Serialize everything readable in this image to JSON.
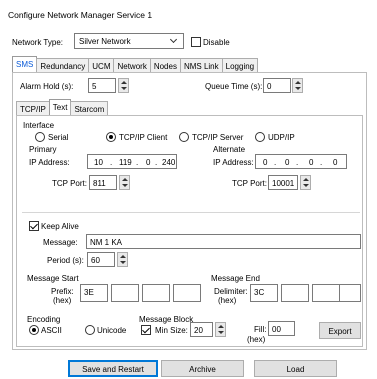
{
  "window": {
    "title": "Configure Network Manager Service 1"
  },
  "network_type": {
    "label": "Network Type:",
    "value": "Silver Network",
    "disable_label": "Disable",
    "disable_checked": false
  },
  "main_tabs": [
    {
      "label": "SMS"
    },
    {
      "label": "Redundancy"
    },
    {
      "label": "UCM"
    },
    {
      "label": "Network"
    },
    {
      "label": "Nodes"
    },
    {
      "label": "NMS Link"
    },
    {
      "label": "Logging"
    }
  ],
  "alarm_hold": {
    "label": "Alarm Hold (s):",
    "value": "5"
  },
  "queue_time": {
    "label": "Queue Time (s):",
    "value": "0"
  },
  "sub_tabs": [
    {
      "label": "TCP/IP"
    },
    {
      "label": "Text"
    },
    {
      "label": "Starcom"
    }
  ],
  "interface": {
    "label": "Interface",
    "options": [
      {
        "label": "Serial",
        "selected": false
      },
      {
        "label": "TCP/IP Client",
        "selected": true
      },
      {
        "label": "TCP/IP Server",
        "selected": false
      },
      {
        "label": "UDP/IP",
        "selected": false
      }
    ],
    "primary": {
      "label": "Primary",
      "ip_label": "IP Address:",
      "ip": [
        "10",
        "119",
        "0",
        "240"
      ],
      "port_label": "TCP Port:",
      "port": "811"
    },
    "alternate": {
      "label": "Alternate",
      "ip_label": "IP Address:",
      "ip": [
        "0",
        "0",
        "0",
        "0"
      ],
      "port_label": "TCP Port:",
      "port": "10001"
    }
  },
  "keep_alive": {
    "label": "Keep Alive",
    "checked": true,
    "message_label": "Message:",
    "message": "NM 1 KA",
    "period_label": "Period (s):",
    "period": "60"
  },
  "message_start": {
    "label": "Message Start",
    "prefix_label": "Prefix:",
    "hex_label": "(hex)",
    "values": [
      "3E",
      "",
      "",
      ""
    ]
  },
  "message_end": {
    "label": "Message End",
    "delimiter_label": "Delimiter:",
    "hex_label": "(hex)",
    "values": [
      "3C",
      "",
      "",
      ""
    ]
  },
  "encoding": {
    "label": "Encoding",
    "options": [
      {
        "label": "ASCII",
        "selected": true
      },
      {
        "label": "Unicode",
        "selected": false
      }
    ]
  },
  "message_block": {
    "label": "Message Block",
    "min_size_label": "Min Size:",
    "min_size_checked": true,
    "min_size": "20",
    "fill_label": "Fill:",
    "fill_hex_label": "(hex)",
    "fill": "00"
  },
  "buttons": {
    "export": "Export",
    "save_restart": "Save and Restart",
    "archive": "Archive",
    "load": "Load"
  }
}
